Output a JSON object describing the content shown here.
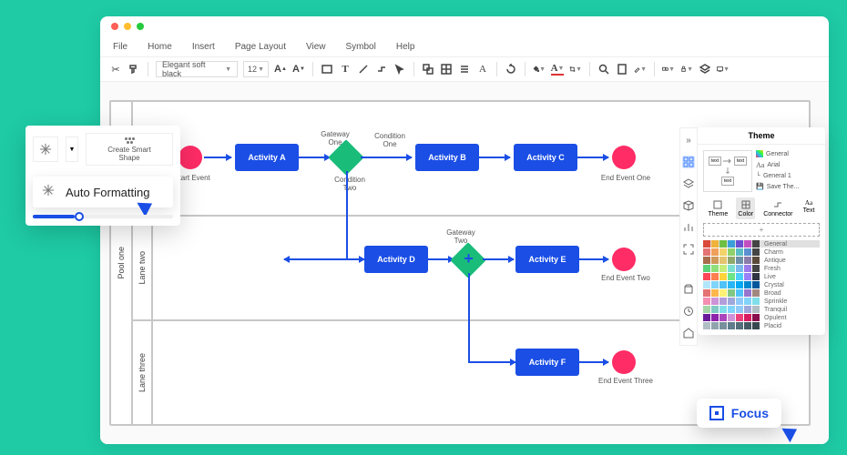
{
  "menu": {
    "items": [
      "File",
      "Home",
      "Insert",
      "Page Layout",
      "View",
      "Symbol",
      "Help"
    ]
  },
  "toolbar": {
    "font": "Elegant soft black",
    "size": "12"
  },
  "pool": {
    "label": "Pool one",
    "lanes": [
      {
        "label": ""
      },
      {
        "label": "Lane two"
      },
      {
        "label": "Lane three"
      }
    ]
  },
  "shapes": {
    "start": "Start Event",
    "a": "Activity A",
    "b": "Activity B",
    "c": "Activity C",
    "d": "Activity D",
    "e": "Activity E",
    "f": "Activity F",
    "g1": "Gateway\nOne",
    "g2": "Gateway\nTwo",
    "c1": "Condition\nOne",
    "c2": "Condition\nTwo",
    "e1": "End Event One",
    "e2": "End Event Two",
    "e3": "End Event Three"
  },
  "popup": {
    "create_shape": "Create Smart\nShape",
    "auto_formatting": "Auto Formatting"
  },
  "side": {
    "title": "Theme",
    "options": {
      "general": "General",
      "font": "Arial",
      "connector": "General 1",
      "save": "Save The..."
    },
    "tabs": {
      "theme": "Theme",
      "color": "Color",
      "connector": "Connector",
      "text": "Text"
    },
    "swatches": [
      "General",
      "Charm",
      "Antique",
      "Fresh",
      "Live",
      "Crystal",
      "Broad",
      "Sprinkle",
      "Tranquil",
      "Opulent",
      "Placid"
    ],
    "add": "+"
  },
  "focus": {
    "label": "Focus"
  },
  "swatch_colors": {
    "General": [
      "#d94a3a",
      "#efb23b",
      "#6fbf45",
      "#3aa0d9",
      "#6a4fd2",
      "#c24fc2",
      "#444"
    ],
    "Charm": [
      "#e57373",
      "#f0a05a",
      "#f3d26a",
      "#8fd16a",
      "#5bbec4",
      "#5b8fd1",
      "#444"
    ],
    "Antique": [
      "#a86b4c",
      "#cf9a5a",
      "#e4c56f",
      "#8fa86b",
      "#6e8fa8",
      "#8a7ca8",
      "#5a4a3a"
    ],
    "Fresh": [
      "#5cd17a",
      "#8fe07a",
      "#c4ed7a",
      "#7ae0d1",
      "#7ab8ed",
      "#9c7aed",
      "#444"
    ],
    "Live": [
      "#ff4757",
      "#ff7f50",
      "#ffd43b",
      "#6be585",
      "#4bcffa",
      "#9980fa",
      "#2f3542"
    ],
    "Crystal": [
      "#b3e5fc",
      "#81d4fa",
      "#4fc3f7",
      "#29b6f6",
      "#03a9f4",
      "#0288d1",
      "#01579b"
    ],
    "Broad": [
      "#e57373",
      "#ffb74d",
      "#fff176",
      "#81c784",
      "#4fc3f7",
      "#9575cd",
      "#a1887f"
    ],
    "Sprinkle": [
      "#f48fb1",
      "#ce93d8",
      "#b39ddb",
      "#9fa8da",
      "#90caf9",
      "#81d4fa",
      "#80deea"
    ],
    "Tranquil": [
      "#a5d6a7",
      "#80cbc4",
      "#80deea",
      "#81d4fa",
      "#90caf9",
      "#9fa8da",
      "#b0bec5"
    ],
    "Opulent": [
      "#6a1b9a",
      "#8e24aa",
      "#ab47bc",
      "#ce93d8",
      "#ec407a",
      "#d81b60",
      "#880e4f"
    ],
    "Placid": [
      "#b0bec5",
      "#90a4ae",
      "#78909c",
      "#607d8b",
      "#546e7a",
      "#455a64",
      "#37474f"
    ]
  }
}
